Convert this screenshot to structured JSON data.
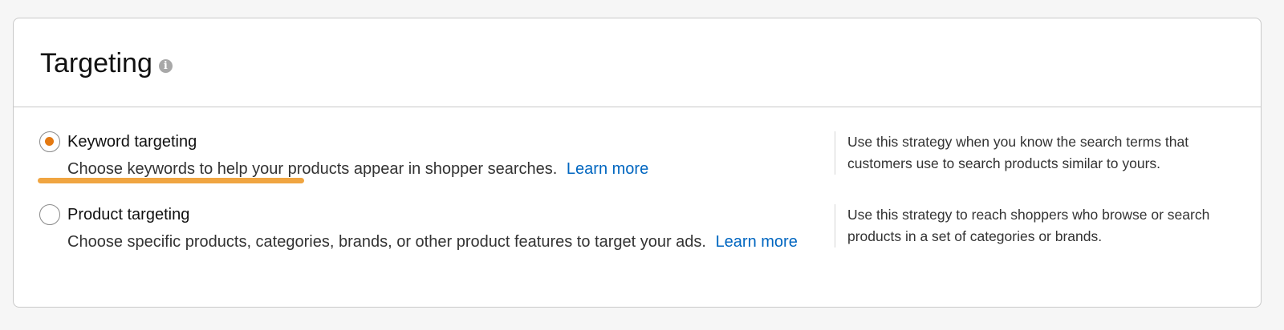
{
  "section": {
    "title": "Targeting",
    "info_icon": "info-icon"
  },
  "options": [
    {
      "label": "Keyword targeting",
      "selected": true,
      "description": "Choose keywords to help your products appear in shopper searches.",
      "link": "Learn more",
      "help": "Use this strategy when you know the search terms that customers use to search products similar to yours."
    },
    {
      "label": "Product targeting",
      "selected": false,
      "description": "Choose specific products, categories, brands, or other product features to target your ads.",
      "link": "Learn more",
      "help": "Use this strategy to reach shoppers who browse or search products in a set of categories or brands."
    }
  ],
  "colors": {
    "accent": "#e47911",
    "highlight": "#f0a541",
    "link": "#0066c0"
  }
}
